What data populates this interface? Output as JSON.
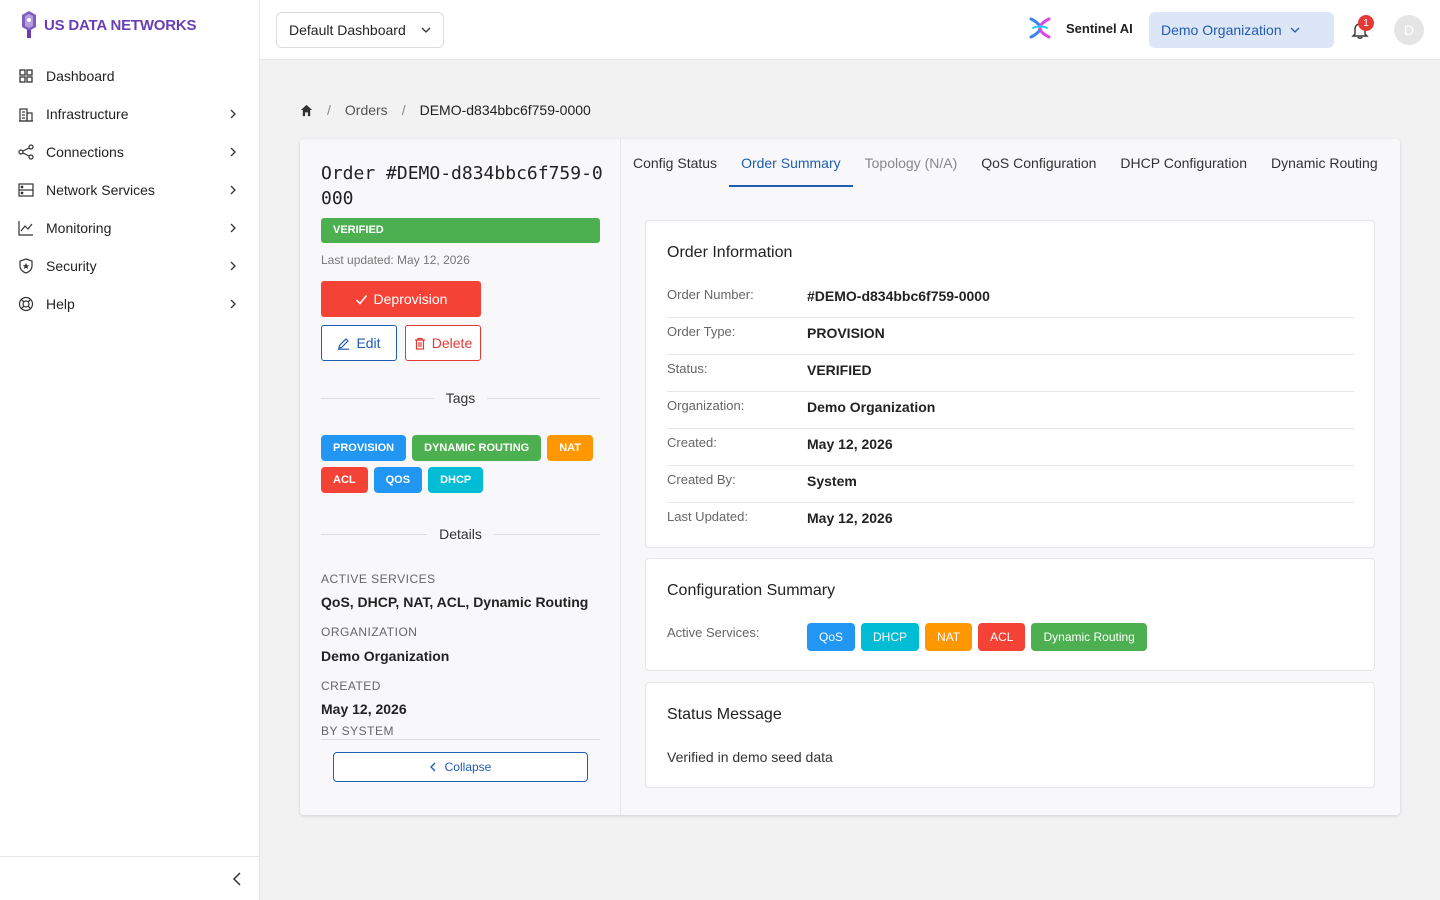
{
  "brand": {
    "name": "US DATA NETWORKS",
    "color": "#6a3fb5"
  },
  "sidebar": {
    "items": [
      {
        "label": "Dashboard",
        "icon": "grid-icon",
        "has_children": false
      },
      {
        "label": "Infrastructure",
        "icon": "building-icon",
        "has_children": true
      },
      {
        "label": "Connections",
        "icon": "share-icon",
        "has_children": true
      },
      {
        "label": "Network Services",
        "icon": "server-icon",
        "has_children": true
      },
      {
        "label": "Monitoring",
        "icon": "chart-line-icon",
        "has_children": true
      },
      {
        "label": "Security",
        "icon": "shield-icon",
        "has_children": true
      },
      {
        "label": "Help",
        "icon": "lifebuoy-icon",
        "has_children": true
      }
    ],
    "collapse_icon": "chevron-left-icon"
  },
  "topbar": {
    "dashboard_select": "Default Dashboard",
    "sentinel_label": "Sentinel AI",
    "org_select": "Demo Organization",
    "notification_count": "1",
    "avatar_initial": "D"
  },
  "breadcrumb": {
    "home_icon": "home-icon",
    "items": [
      "Orders",
      "DEMO-d834bbc6f759-0000"
    ]
  },
  "order": {
    "title": "Order #DEMO-d834bbc6f759-0000",
    "status": "VERIFIED",
    "status_color": "#4caf50",
    "last_updated": "Last updated: May 12, 2026",
    "deprovision_label": "Deprovision",
    "edit_label": "Edit",
    "delete_label": "Delete",
    "tags_heading": "Tags",
    "tags": [
      {
        "label": "PROVISION",
        "color": "#2196f3"
      },
      {
        "label": "DYNAMIC ROUTING",
        "color": "#4caf50"
      },
      {
        "label": "NAT",
        "color": "#ff9800"
      },
      {
        "label": "ACL",
        "color": "#f44336"
      },
      {
        "label": "QOS",
        "color": "#2196f3"
      },
      {
        "label": "DHCP",
        "color": "#00bcd4"
      }
    ],
    "details_heading": "Details",
    "details": {
      "active_services_label": "ACTIVE SERVICES",
      "active_services_value": "QoS, DHCP, NAT, ACL, Dynamic Routing",
      "organization_label": "ORGANIZATION",
      "organization_value": "Demo Organization",
      "created_label": "CREATED",
      "created_value": "May 12, 2026",
      "created_by": "BY SYSTEM"
    },
    "collapse_label": "Collapse"
  },
  "tabs": [
    {
      "label": "Config Status",
      "state": "normal"
    },
    {
      "label": "Order Summary",
      "state": "active"
    },
    {
      "label": "Topology (N/A)",
      "state": "disabled"
    },
    {
      "label": "QoS Configuration",
      "state": "normal"
    },
    {
      "label": "DHCP Configuration",
      "state": "normal"
    },
    {
      "label": "Dynamic Routing",
      "state": "normal"
    }
  ],
  "order_information": {
    "title": "Order Information",
    "rows": [
      {
        "label": "Order Number:",
        "value": "#DEMO-d834bbc6f759-0000"
      },
      {
        "label": "Order Type:",
        "value": "PROVISION"
      },
      {
        "label": "Status:",
        "value": "VERIFIED"
      },
      {
        "label": "Organization:",
        "value": "Demo Organization"
      },
      {
        "label": "Created:",
        "value": "May 12, 2026"
      },
      {
        "label": "Created By:",
        "value": "System"
      },
      {
        "label": "Last Updated:",
        "value": "May 12, 2026"
      }
    ]
  },
  "configuration_summary": {
    "title": "Configuration Summary",
    "active_services_label": "Active Services:",
    "services": [
      {
        "label": "QoS",
        "color": "#2196f3"
      },
      {
        "label": "DHCP",
        "color": "#00bcd4"
      },
      {
        "label": "NAT",
        "color": "#ff9800"
      },
      {
        "label": "ACL",
        "color": "#f44336"
      },
      {
        "label": "Dynamic Routing",
        "color": "#4caf50"
      }
    ]
  },
  "status_message": {
    "title": "Status Message",
    "text": "Verified in demo seed data"
  }
}
